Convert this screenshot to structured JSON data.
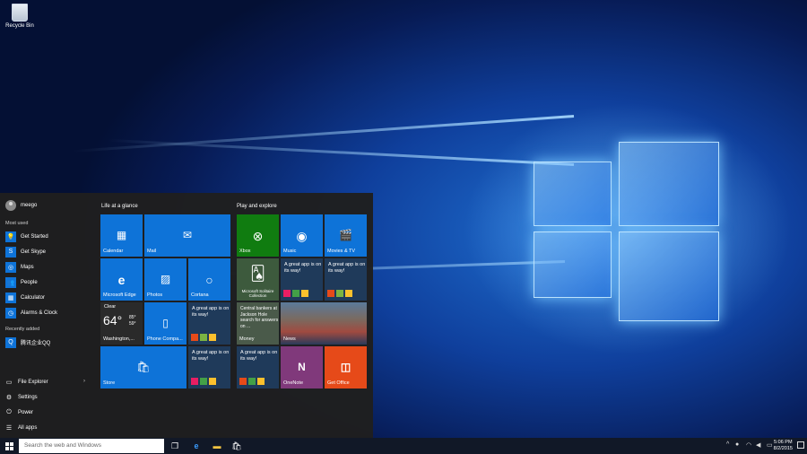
{
  "desktop": {
    "recycle_bin": "Recycle Bin"
  },
  "start_menu": {
    "user": "meego",
    "most_used_label": "Most used",
    "most_used": [
      {
        "label": "Get Started",
        "icon": "lightbulb-icon",
        "glyph": "💡"
      },
      {
        "label": "Get Skype",
        "icon": "skype-icon",
        "glyph": "S"
      },
      {
        "label": "Maps",
        "icon": "map-icon",
        "glyph": "◎"
      },
      {
        "label": "People",
        "icon": "people-icon",
        "glyph": "👥"
      },
      {
        "label": "Calculator",
        "icon": "calculator-icon",
        "glyph": "▦"
      },
      {
        "label": "Alarms & Clock",
        "icon": "clock-icon",
        "glyph": "◷"
      }
    ],
    "recently_added_label": "Recently added",
    "recently_added": [
      {
        "label": "腾讯企业QQ",
        "icon": "qq-icon",
        "glyph": "Q"
      }
    ],
    "bottom": [
      {
        "label": "File Explorer",
        "icon": "folder-icon",
        "glyph": "▭"
      },
      {
        "label": "Settings",
        "icon": "gear-icon",
        "glyph": "⚙"
      },
      {
        "label": "Power",
        "icon": "power-icon",
        "glyph": "⏻"
      },
      {
        "label": "All apps",
        "icon": "list-icon",
        "glyph": "☰"
      }
    ],
    "groups": {
      "life": "Life at a glance",
      "play": "Play and explore"
    },
    "tiles": {
      "calendar": "Calendar",
      "mail": "Mail",
      "edge": "Microsoft Edge",
      "photos": "Photos",
      "cortana": "Cortana",
      "weather_condition": "Clear",
      "weather_temp": "64°",
      "weather_high": "85°",
      "weather_low": "59°",
      "weather_city": "Washington,...",
      "phone": "Phone Compa...",
      "promo": "A great app is on its way!",
      "store": "Store",
      "xbox": "Xbox",
      "music": "Music",
      "movies": "Movies & TV",
      "solitaire": "Microsoft Solitaire Collection",
      "money_news": "Central bankers at Jackson Hole search for answers on ...",
      "money": "Money",
      "news": "News",
      "onenote": "OneNote",
      "office": "Get Office"
    }
  },
  "taskbar": {
    "search_placeholder": "Search the web and Windows",
    "time": "5:06 PM",
    "date": "8/2/2015"
  },
  "colors": {
    "accent": "#0e73d8",
    "xbox": "#107c10",
    "onenote": "#80397b",
    "office": "#e64a19"
  }
}
